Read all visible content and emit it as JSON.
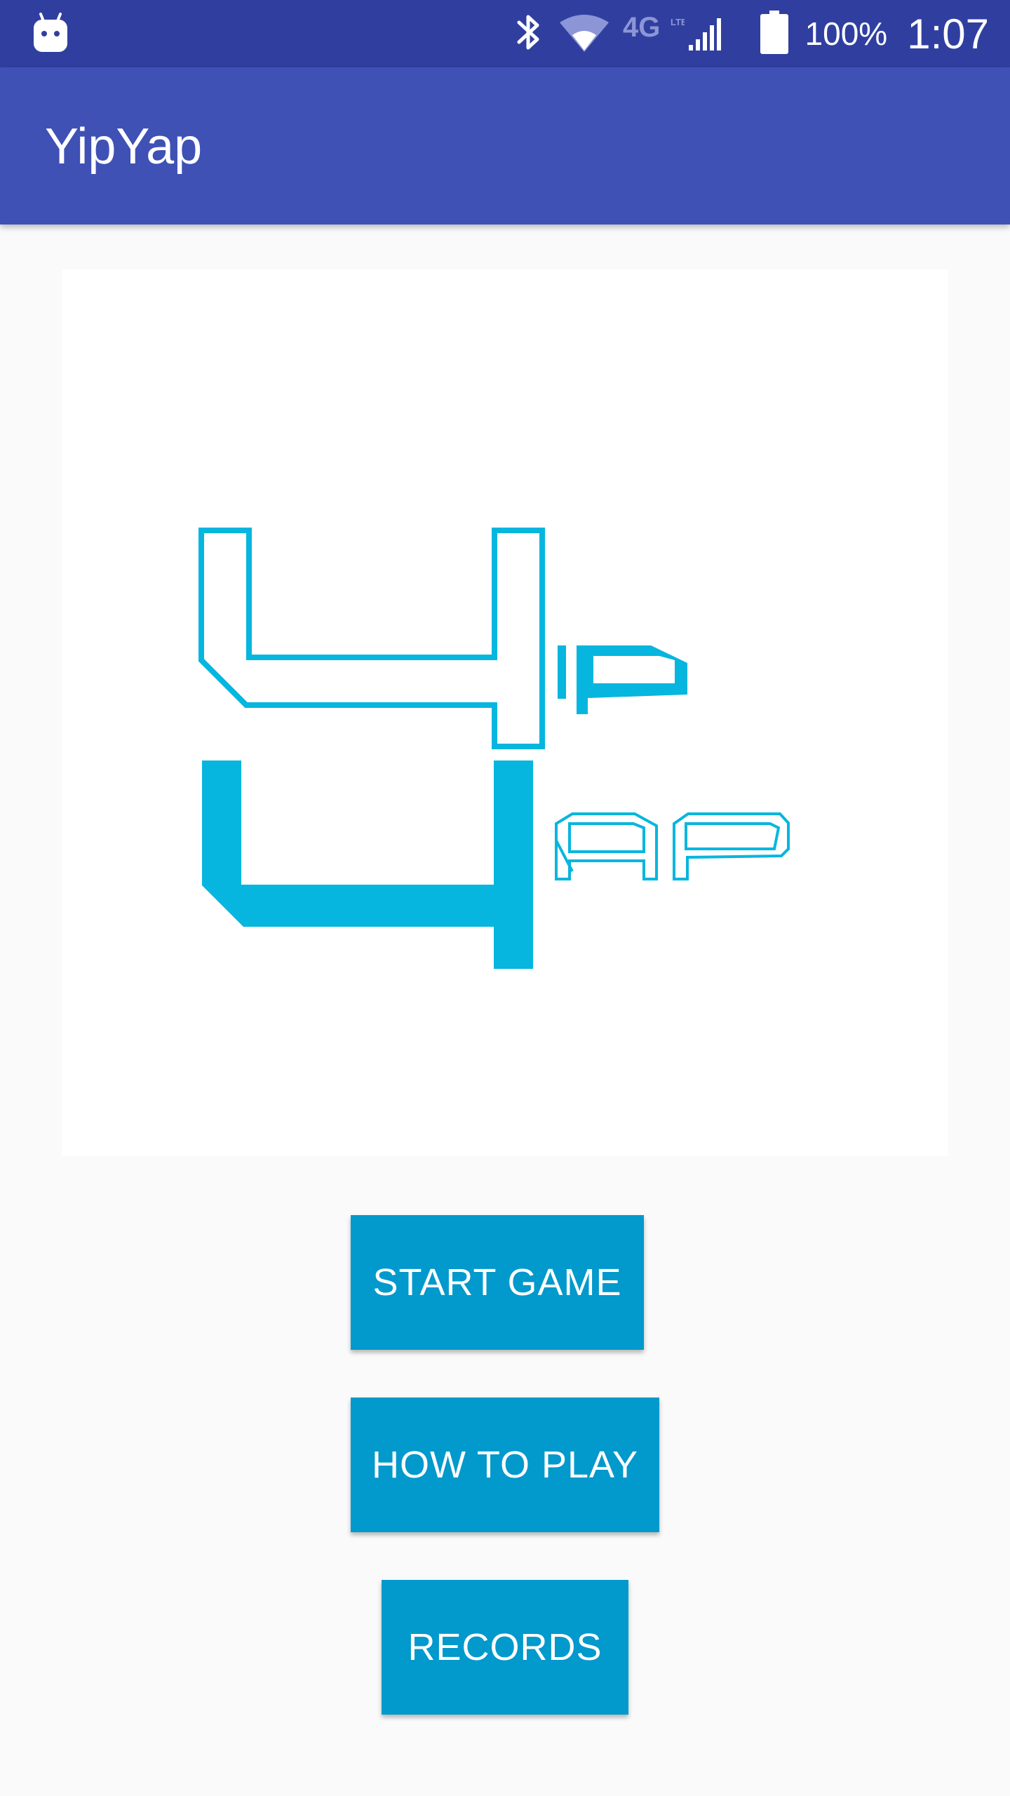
{
  "status_bar": {
    "icons": [
      "android-notification-icon",
      "bluetooth-icon",
      "wifi-icon",
      "4g-lte-icon",
      "signal-icon",
      "battery-icon"
    ],
    "network_label": "4G",
    "battery_percent": "100%",
    "time": "1:07"
  },
  "app_bar": {
    "title": "YipYap"
  },
  "logo": {
    "icon": "yipyap-logo",
    "text": "YipYap",
    "color": "#06b6de"
  },
  "menu": {
    "start_game_label": "START GAME",
    "how_to_play_label": "HOW TO PLAY",
    "records_label": "RECORDS"
  },
  "colors": {
    "status_bar": "#303f9f",
    "app_bar": "#3f51b5",
    "button": "#0299cc",
    "logo": "#06b6de",
    "background": "#fafafa"
  }
}
